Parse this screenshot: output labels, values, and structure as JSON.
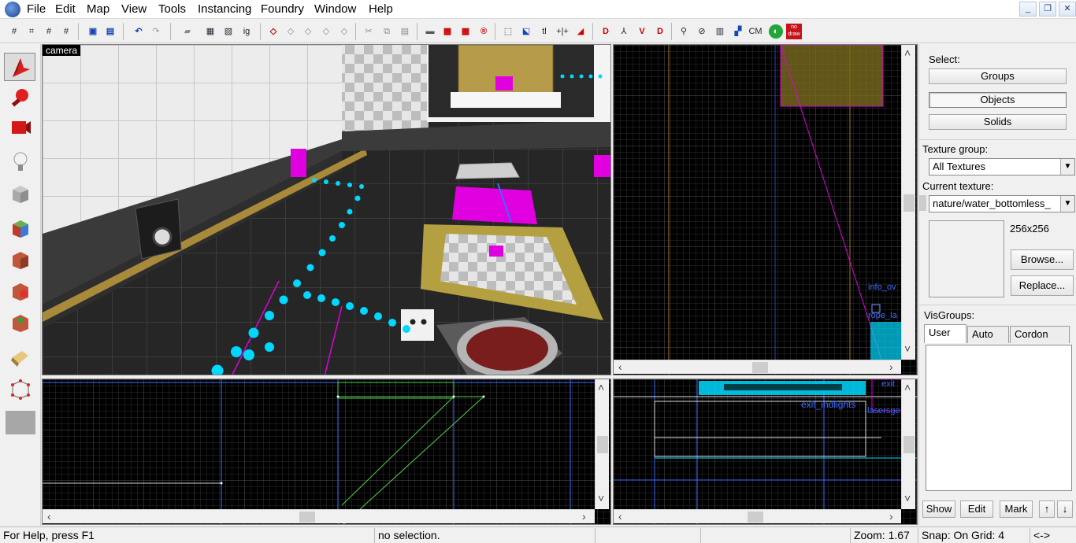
{
  "menu": [
    "File",
    "Edit",
    "Map",
    "View",
    "Tools",
    "Instancing",
    "Foundry",
    "Window",
    "Help"
  ],
  "window_buttons": [
    "_",
    "❐",
    "✕"
  ],
  "toolbar": {
    "grid_icons": [
      "#",
      "⌗",
      "#",
      "#"
    ],
    "misc_labels": [
      "ig",
      "tl",
      "+|+",
      "CM"
    ],
    "nodraw_label": "no draw"
  },
  "viewports": {
    "camera_label": "camera",
    "top_right_labels": [
      "info_ov",
      "rope_la"
    ],
    "bottom_right_labels": [
      "exit_indlights",
      "lasersge",
      "exit"
    ]
  },
  "right_panel": {
    "select_label": "Select:",
    "select_buttons": [
      "Groups",
      "Objects",
      "Solids"
    ],
    "texture_group_label": "Texture group:",
    "texture_group_value": "All Textures",
    "current_texture_label": "Current texture:",
    "current_texture_value": "nature/water_bottomless_",
    "texture_size": "256x256",
    "browse_button": "Browse...",
    "replace_button": "Replace...",
    "visgroups_label": "VisGroups:",
    "tabs": [
      "User",
      "Auto",
      "Cordon"
    ],
    "bottom_buttons": [
      "Show",
      "Edit",
      "Mark"
    ]
  },
  "status": {
    "help": "For Help, press F1",
    "selection": "no selection.",
    "zoom": "Zoom: 1.67",
    "snap": "Snap: On Grid: 4",
    "arrows": "<->"
  },
  "colors": {
    "accent_magenta": "#e000e0",
    "accent_cyan": "#00e5ff",
    "wire_green": "#4fd24f",
    "wire_blue": "#3a6bff"
  }
}
